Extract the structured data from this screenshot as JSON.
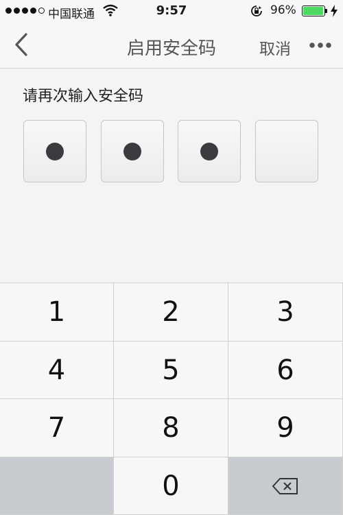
{
  "status_bar": {
    "carrier": "中国联通",
    "time": "9:57",
    "battery_percent": "96%",
    "battery_level": 0.96,
    "battery_color": "#4cd964"
  },
  "nav": {
    "title": "启用安全码",
    "cancel_label": "取消",
    "back_icon": "chevron-left-icon",
    "more_icon": "ellipsis-icon"
  },
  "content": {
    "prompt": "请再次输入安全码",
    "code_boxes": [
      {
        "filled": true
      },
      {
        "filled": true
      },
      {
        "filled": true
      },
      {
        "filled": false
      }
    ]
  },
  "keypad": {
    "keys": [
      "1",
      "2",
      "3",
      "4",
      "5",
      "6",
      "7",
      "8",
      "9",
      "",
      "0",
      "delete"
    ]
  }
}
